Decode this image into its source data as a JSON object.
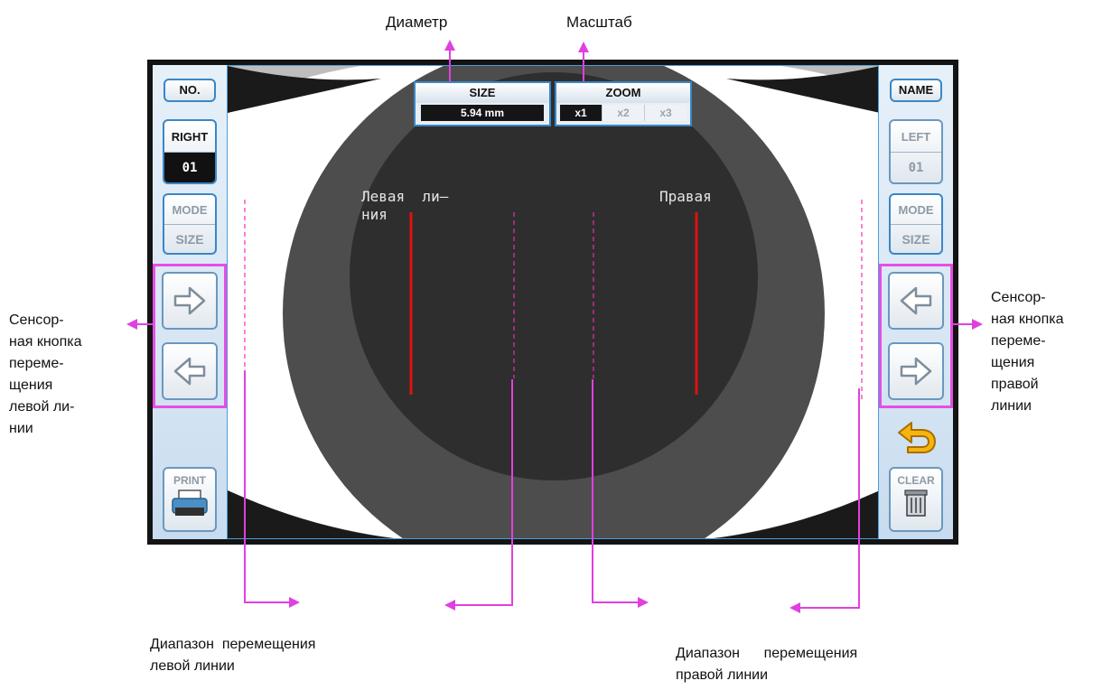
{
  "annotations": {
    "diameter": "Диаметр",
    "zoom": "Масштаб",
    "left_touch_button": [
      "Сенсор-",
      "ная кнопка",
      "переме-",
      "щения",
      "левой ли-",
      "нии"
    ],
    "right_touch_button": [
      "Сенсор-",
      "ная кнопка",
      "переме-",
      "щения",
      "правой",
      "линии"
    ],
    "left_range": [
      "Диапазон  перемещения",
      "левой линии"
    ],
    "right_range": [
      "Диапазон      перемещения",
      "правой линии"
    ]
  },
  "left_panel": {
    "no_label": "NO.",
    "eye_label": "RIGHT",
    "eye_number": "01",
    "mode_label": "MODE",
    "mode_value": "SIZE",
    "arrow_up": "right-arrow-icon",
    "arrow_down": "left-arrow-icon",
    "print_label": "PRINT"
  },
  "right_panel": {
    "name_label": "NAME",
    "eye_label": "LEFT",
    "eye_number": "01",
    "mode_label": "MODE",
    "mode_value": "SIZE",
    "arrow_up": "left-arrow-icon",
    "arrow_down": "right-arrow-icon",
    "back_icon": "undo-arrow-icon",
    "clear_label": "CLEAR"
  },
  "screen": {
    "size_title": "SIZE",
    "size_value": "5.94 mm",
    "zoom_title": "ZOOM",
    "zoom_options": [
      "x1",
      "x2",
      "x3"
    ],
    "zoom_selected": "x1",
    "left_line_label": [
      "Левая  ли–",
      "ния"
    ],
    "right_line_label": "Правая"
  },
  "colors": {
    "frame": "#141414",
    "screen_border": "#4c9ed8",
    "button_border": "#3a86c6",
    "highlight": "#e64ee6",
    "measure_line": "#e01010",
    "iris_outer": "#4d4d4d",
    "pupil": "#2e2e2e"
  }
}
